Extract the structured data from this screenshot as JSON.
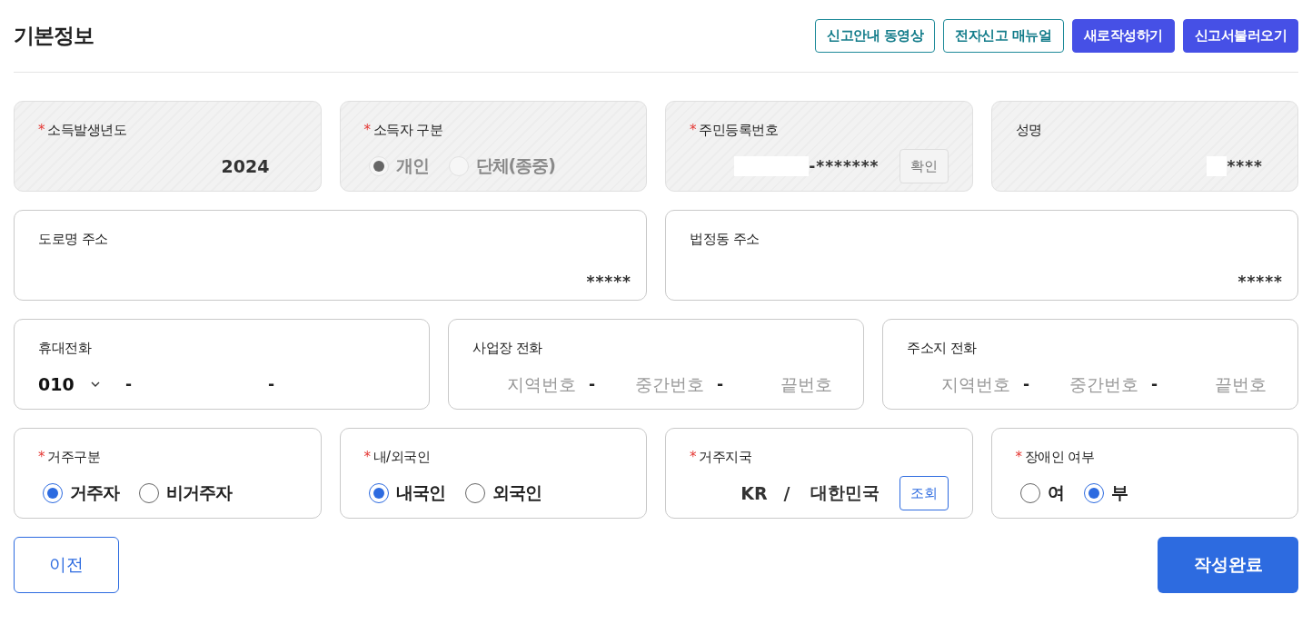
{
  "title": "기본정보",
  "required_mark": "*",
  "header_buttons": [
    {
      "label": "신고안내 동영상",
      "kind": "outline"
    },
    {
      "label": "전자신고 매뉴얼",
      "kind": "outline"
    },
    {
      "label": "새로작성하기",
      "kind": "filled"
    },
    {
      "label": "신고서불러오기",
      "kind": "filled"
    }
  ],
  "rows": [
    [
      {
        "kind": "value",
        "label": "소득발생년도",
        "required": true,
        "disabled": true,
        "value": "2024"
      },
      {
        "kind": "radio",
        "label": "소득자 구분",
        "required": true,
        "disabled": true,
        "options": [
          {
            "label": "개인",
            "selected": true
          },
          {
            "label": "단체(종중)",
            "selected": false
          }
        ]
      },
      {
        "kind": "id_number",
        "label": "주민등록번호",
        "required": true,
        "disabled": true,
        "value": "-*******",
        "button": "확인"
      },
      {
        "kind": "masked",
        "label": "성명",
        "required": false,
        "disabled": true,
        "value": "****"
      }
    ],
    [
      {
        "kind": "address",
        "label": "도로명 주소",
        "required": false,
        "disabled": false,
        "value": "*****"
      },
      {
        "kind": "address",
        "label": "법정동 주소",
        "required": false,
        "disabled": false,
        "value": "*****"
      }
    ],
    [
      {
        "kind": "phone",
        "label": "휴대전화",
        "required": false,
        "disabled": false,
        "parts": [
          {
            "kind": "select",
            "value": "010"
          },
          {
            "kind": "separator",
            "value": "-"
          },
          {
            "kind": "input"
          },
          {
            "kind": "separator",
            "value": "-"
          },
          {
            "kind": "input"
          }
        ]
      },
      {
        "kind": "phone",
        "label": "사업장 전화",
        "required": false,
        "disabled": false,
        "parts": [
          {
            "kind": "input",
            "placeholder": "지역번호"
          },
          {
            "kind": "separator",
            "value": "-"
          },
          {
            "kind": "input",
            "placeholder": "중간번호"
          },
          {
            "kind": "separator",
            "value": "-"
          },
          {
            "kind": "input",
            "placeholder": "끝번호"
          }
        ]
      },
      {
        "kind": "phone",
        "label": "주소지 전화",
        "required": false,
        "disabled": false,
        "parts": [
          {
            "kind": "input",
            "placeholder": "지역번호"
          },
          {
            "kind": "separator",
            "value": "-"
          },
          {
            "kind": "input",
            "placeholder": "중간번호"
          },
          {
            "kind": "separator",
            "value": "-"
          },
          {
            "kind": "input",
            "placeholder": "끝번호"
          }
        ]
      }
    ],
    [
      {
        "kind": "radio",
        "label": "거주구분",
        "required": true,
        "disabled": false,
        "options": [
          {
            "label": "거주자",
            "selected": true
          },
          {
            "label": "비거주자",
            "selected": false
          }
        ]
      },
      {
        "kind": "radio",
        "label": "내/외국인",
        "required": true,
        "disabled": false,
        "options": [
          {
            "label": "내국인",
            "selected": true
          },
          {
            "label": "외국인",
            "selected": false
          }
        ]
      },
      {
        "kind": "country",
        "label": "거주지국",
        "required": true,
        "disabled": false,
        "code": "KR",
        "separator": "/",
        "value": "대한민국",
        "button": "조회"
      },
      {
        "kind": "radio",
        "label": "장애인 여부",
        "required": true,
        "disabled": false,
        "options": [
          {
            "label": "여",
            "selected": false
          },
          {
            "label": "부",
            "selected": true
          }
        ]
      }
    ]
  ],
  "footer": {
    "prev": "이전",
    "submit": "작성완료"
  }
}
